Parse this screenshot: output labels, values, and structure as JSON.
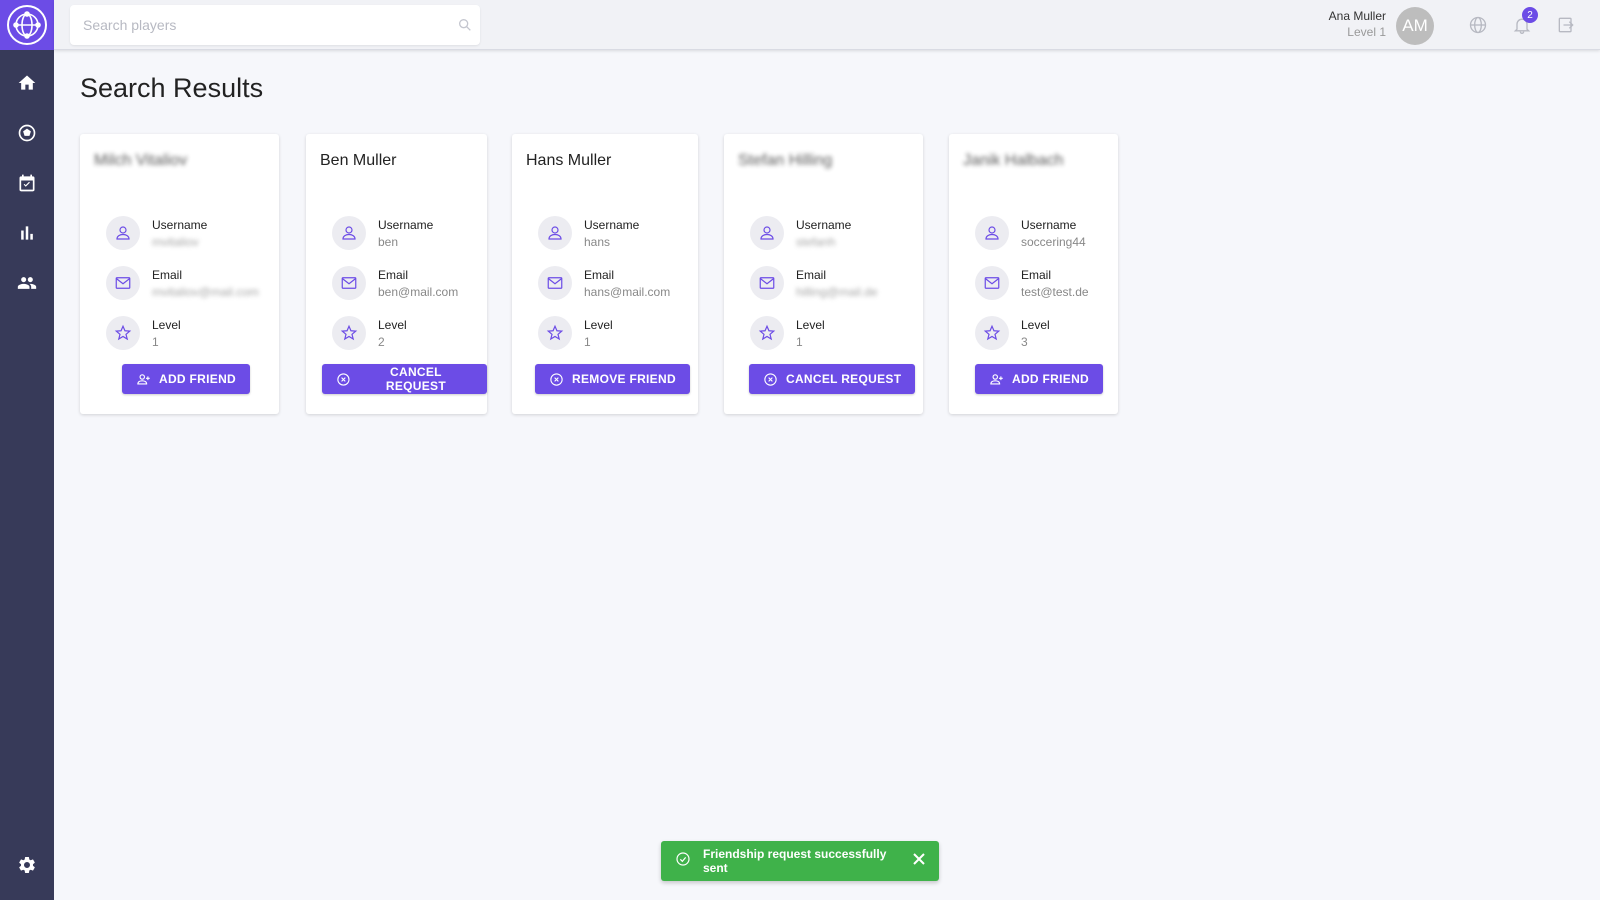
{
  "search": {
    "placeholder": "Search players"
  },
  "user": {
    "name": "Ana Muller",
    "level": "Level 1",
    "initials": "AM",
    "notifications": "2"
  },
  "page": {
    "title": "Search Results"
  },
  "labels": {
    "username": "Username",
    "email": "Email",
    "level": "Level"
  },
  "cards": [
    {
      "name": "Milch Vitaliov",
      "username": "mvitaliov",
      "email": "mvitaliov@mail.com",
      "level": "1",
      "action": "ADD FRIEND"
    },
    {
      "name": "Ben Muller",
      "username": "ben",
      "email": "ben@mail.com",
      "level": "2",
      "action": "CANCEL REQUEST"
    },
    {
      "name": "Hans Muller",
      "username": "hans",
      "email": "hans@mail.com",
      "level": "1",
      "action": "REMOVE FRIEND"
    },
    {
      "name": "Stefan Hilling",
      "username": "stefanh",
      "email": "hilling@mail.de",
      "level": "1",
      "action": "CANCEL REQUEST"
    },
    {
      "name": "Janik Halbach",
      "username": "soccering44",
      "email": "test@test.de",
      "level": "3",
      "action": "ADD FRIEND"
    }
  ],
  "toast": {
    "message": "Friendship request successfully sent"
  },
  "colors": {
    "accent": "#6c4ce6",
    "sidebar": "#373a59",
    "success": "#3fb24a"
  }
}
